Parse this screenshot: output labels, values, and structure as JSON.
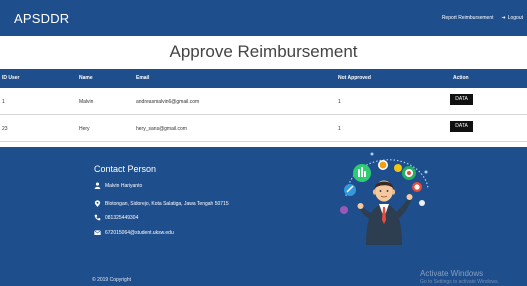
{
  "navbar": {
    "brand": "APSDDR",
    "links": [
      {
        "label": "Report Reimbursement"
      },
      {
        "label": "Logout",
        "icon": "logout-icon"
      }
    ]
  },
  "page": {
    "title": "Approve Reimbursement"
  },
  "table": {
    "columns": [
      "ID User",
      "Name",
      "Email",
      "Not Approved",
      "Action"
    ],
    "rows": [
      {
        "id": "1",
        "name": "Malvin",
        "email": "andreasmalvin6@gmail.com",
        "not_approved": "1",
        "action": "DATA"
      },
      {
        "id": "23",
        "name": "Hery",
        "email": "hery_sans@gmail.com",
        "not_approved": "1",
        "action": "DATA"
      }
    ]
  },
  "footer": {
    "contact_title": "Contact Person",
    "contacts": [
      {
        "icon": "user-icon",
        "text": "Malvin Hariyanto"
      },
      {
        "icon": "location-pin-icon",
        "text": "Blotongan, Sidorejo, Kota Salatiga, Jawa Tengah 50715"
      },
      {
        "icon": "phone-icon",
        "text": "081325449304"
      },
      {
        "icon": "mail-icon",
        "text": "672015064@student.uksw.edu"
      }
    ],
    "copyright": "© 2019 Copyright",
    "watermark_title": "Activate Windows",
    "watermark_sub": "Go to Settings to activate Windows.",
    "illustration": "businessman-with-icons-illustration"
  },
  "colors": {
    "primary": "#1f4e8c",
    "button": "#111111",
    "row_border": "#d6d6d6"
  }
}
